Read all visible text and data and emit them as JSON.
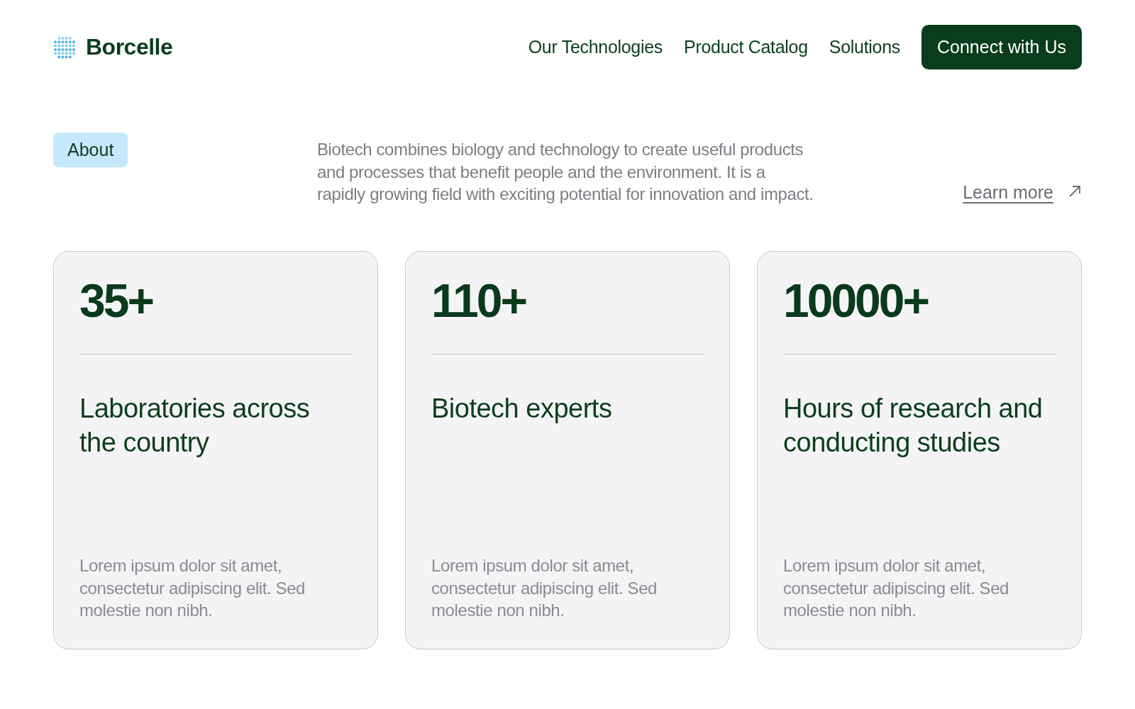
{
  "brand": {
    "name": "Borcelle"
  },
  "nav": {
    "links": [
      "Our Technologies",
      "Product Catalog",
      "Solutions"
    ],
    "cta": "Connect with Us"
  },
  "about": {
    "tag": "About",
    "text": "Biotech combines biology and technology to create useful products and processes that benefit people and the environment. It is a rapidly growing field with exciting potential for innovation and impact.",
    "link": "Learn more"
  },
  "stats": [
    {
      "value": "35+",
      "title": "Laboratories across the country",
      "text": "Lorem ipsum dolor sit amet, consectetur adipiscing elit. Sed molestie non nibh."
    },
    {
      "value": "110+",
      "title": "Biotech experts",
      "text": "Lorem ipsum dolor sit amet, consectetur adipiscing elit. Sed molestie non nibh."
    },
    {
      "value": "10000+",
      "title": "Hours of research and conducting studies",
      "text": "Lorem ipsum dolor sit amet, consectetur adipiscing elit. Sed molestie non nibh."
    }
  ]
}
